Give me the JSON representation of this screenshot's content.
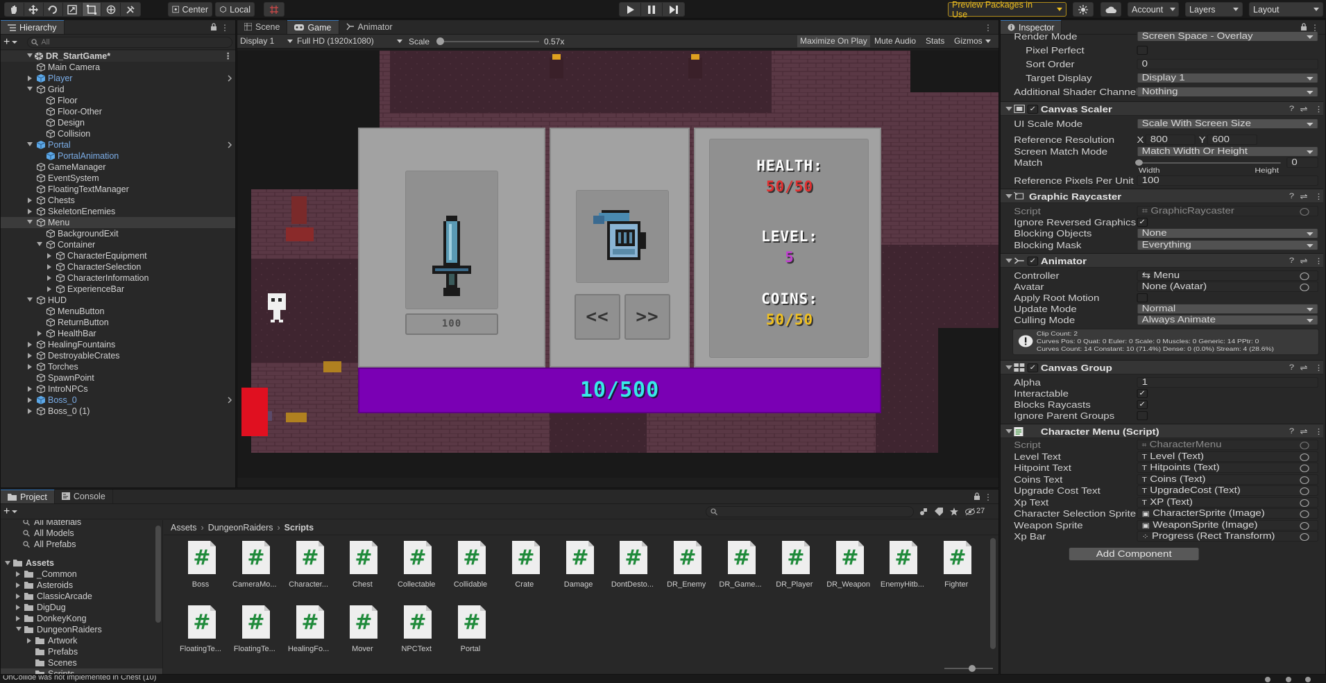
{
  "toolbar": {
    "pivot_mode": "Center",
    "pivot_space": "Local",
    "preview_packages": "Preview Packages in Use",
    "account": "Account",
    "layers": "Layers",
    "layout": "Layout"
  },
  "hierarchy": {
    "tab": "Hierarchy",
    "search_placeholder": "All",
    "scene": "DR_StartGame*",
    "items": [
      {
        "label": "Main Camera"
      },
      {
        "label": "Player"
      },
      {
        "label": "Grid"
      },
      {
        "label": "Floor"
      },
      {
        "label": "Floor-Other"
      },
      {
        "label": "Design"
      },
      {
        "label": "Collision"
      },
      {
        "label": "Portal"
      },
      {
        "label": "PortalAnimation"
      },
      {
        "label": "GameManager"
      },
      {
        "label": "EventSystem"
      },
      {
        "label": "FloatingTextManager"
      },
      {
        "label": "Chests"
      },
      {
        "label": "SkeletonEnemies"
      },
      {
        "label": "Menu"
      },
      {
        "label": "BackgroundExit"
      },
      {
        "label": "Container"
      },
      {
        "label": "CharacterEquipment"
      },
      {
        "label": "CharacterSelection"
      },
      {
        "label": "CharacterInformation"
      },
      {
        "label": "ExperienceBar"
      },
      {
        "label": "HUD"
      },
      {
        "label": "MenuButton"
      },
      {
        "label": "ReturnButton"
      },
      {
        "label": "HealthBar"
      },
      {
        "label": "HealingFountains"
      },
      {
        "label": "DestroyableCrates"
      },
      {
        "label": "Torches"
      },
      {
        "label": "SpawnPoint"
      },
      {
        "label": "IntroNPCs"
      },
      {
        "label": "Boss_0"
      },
      {
        "label": "Boss_0 (1)"
      }
    ]
  },
  "center_tabs": {
    "scene": "Scene",
    "game": "Game",
    "animator": "Animator"
  },
  "game_bar": {
    "display": "Display 1",
    "resolution": "Full HD (1920x1080)",
    "scale_label": "Scale",
    "scale_value": "0.57x",
    "scale_fraction": 0.02,
    "maximize": "Maximize On Play",
    "mute": "Mute Audio",
    "stats": "Stats",
    "gizmos": "Gizmos"
  },
  "game_menu": {
    "weapon_cost": "100",
    "health_label": "HEALTH:",
    "health_value": "50/50",
    "level_label": "LEVEL:",
    "level_value": "5",
    "coins_label": "COINS:",
    "coins_value": "50/50",
    "xp_text": "10/500",
    "prev_arrow": "<<",
    "next_arrow": ">>"
  },
  "project": {
    "tab": "Project",
    "console_tab": "Console",
    "hidden_count": "27",
    "favorites": [
      "All Materials",
      "All Models",
      "All Prefabs"
    ],
    "assets_label": "Assets",
    "folders": [
      {
        "label": "_Common"
      },
      {
        "label": "Asteroids"
      },
      {
        "label": "ClassicArcade"
      },
      {
        "label": "DigDug"
      },
      {
        "label": "DonkeyKong"
      },
      {
        "label": "DungeonRaiders"
      },
      {
        "label": "Artwork"
      },
      {
        "label": "Prefabs"
      },
      {
        "label": "Scenes"
      },
      {
        "label": "Scripts"
      }
    ],
    "breadcrumb": [
      "Assets",
      "DungeonRaiders",
      "Scripts"
    ],
    "scripts": [
      "Boss",
      "CameraMo...",
      "Character...",
      "Chest",
      "Collectable",
      "Collidable",
      "Crate",
      "Damage",
      "DontDesto...",
      "DR_Enemy",
      "DR_Game...",
      "DR_Player",
      "DR_Weapon",
      "EnemyHitb...",
      "Fighter",
      "FloatingTe...",
      "FloatingTe...",
      "HealingFo...",
      "Mover",
      "NPCText",
      "Portal"
    ]
  },
  "status_bar": {
    "message": "OnCollide was not implemented in Chest (10)"
  },
  "inspector": {
    "tab": "Inspector",
    "canvas_rows": [
      {
        "label": "Render Mode",
        "value": "Screen Space - Overlay"
      },
      {
        "label": "Pixel Perfect"
      },
      {
        "label": "Sort Order",
        "value": "0"
      },
      {
        "label": "Target Display",
        "value": "Display 1"
      },
      {
        "label": "Additional Shader Channels",
        "value": "Nothing"
      }
    ],
    "canvas_scaler": {
      "title": "Canvas Scaler",
      "ui_scale_mode_label": "UI Scale Mode",
      "ui_scale_mode": "Scale With Screen Size",
      "ref_res_label": "Reference Resolution",
      "ref_x": "800",
      "ref_y": "600",
      "match_mode_label": "Screen Match Mode",
      "match_mode": "Match Width Or Height",
      "match_label": "Match",
      "match_value": "0",
      "width": "Width",
      "height": "Height",
      "ppu_label": "Reference Pixels Per Unit",
      "ppu": "100"
    },
    "raycaster": {
      "title": "Graphic Raycaster",
      "script_label": "Script",
      "script": "GraphicRaycaster",
      "ignore_label": "Ignore Reversed Graphics",
      "blocking_objects_label": "Blocking Objects",
      "blocking_objects": "None",
      "blocking_mask_label": "Blocking Mask",
      "blocking_mask": "Everything"
    },
    "animator": {
      "title": "Animator",
      "controller_label": "Controller",
      "controller": "Menu",
      "avatar_label": "Avatar",
      "avatar": "None (Avatar)",
      "root_motion_label": "Apply Root Motion",
      "update_mode_label": "Update Mode",
      "update_mode": "Normal",
      "culling_label": "Culling Mode",
      "culling": "Always Animate",
      "info1": "Clip Count: 2",
      "info2": "Curves Pos: 0 Quat: 0 Euler: 0 Scale: 0 Muscles: 0 Generic: 14 PPtr: 0",
      "info3": "Curves Count: 14 Constant: 10 (71.4%) Dense: 0 (0.0%) Stream: 4 (28.6%)"
    },
    "canvas_group": {
      "title": "Canvas Group",
      "alpha_label": "Alpha",
      "alpha": "1",
      "interactable_label": "Interactable",
      "blocks_label": "Blocks Raycasts",
      "ignore_parent_label": "Ignore Parent Groups"
    },
    "character_menu": {
      "title": "Character Menu (Script)",
      "fields": [
        {
          "label": "Script",
          "value": "CharacterMenu"
        },
        {
          "label": "Level Text",
          "value": "Level (Text)"
        },
        {
          "label": "Hitpoint Text",
          "value": "Hitpoints (Text)"
        },
        {
          "label": "Coins Text",
          "value": "Coins (Text)"
        },
        {
          "label": "Upgrade Cost Text",
          "value": "UpgradeCost (Text)"
        },
        {
          "label": "Xp Text",
          "value": "XP (Text)"
        },
        {
          "label": "Character Selection Sprite",
          "value": "CharacterSprite (Image)"
        },
        {
          "label": "Weapon Sprite",
          "value": "WeaponSprite (Image)"
        },
        {
          "label": "Xp Bar",
          "value": "Progress (Rect Transform)"
        }
      ]
    },
    "add_component": "Add Component"
  }
}
